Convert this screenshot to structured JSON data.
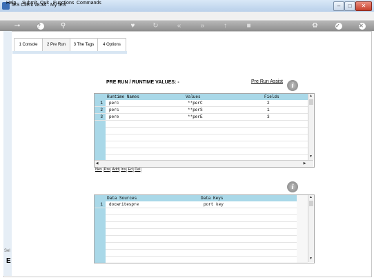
{
  "window": {
    "title": "IES Client v8.34 : My IES",
    "menu": [
      "Help",
      "Submit",
      "Quit",
      "Functions",
      "Commands"
    ]
  },
  "toolbar": {
    "icons": [
      "key-icon",
      "help-icon",
      "search-icon",
      "heart-icon",
      "refresh-icon",
      "rewind-icon",
      "fast-forward-icon",
      "upload-icon",
      "stop-icon",
      "settings-icon",
      "check-icon",
      "close-icon"
    ]
  },
  "tabs": [
    {
      "label": "1 Console"
    },
    {
      "label": "2 Pre Run"
    },
    {
      "label": "3 The Tags"
    },
    {
      "label": "4 Options"
    }
  ],
  "prerun": {
    "title": "PRE RUN / RUNTIME VALUES: -",
    "assist_link": "Pre Run Assist",
    "columns": [
      "Runtime Names",
      "Values",
      "Fields"
    ],
    "rows": [
      {
        "num": "1",
        "name": "perc",
        "value": "**perC",
        "field": "2"
      },
      {
        "num": "2",
        "name": "pers",
        "value": "**perS",
        "field": "1"
      },
      {
        "num": "3",
        "name": "pere",
        "value": "**perE",
        "field": "3"
      }
    ],
    "buttons": [
      "Nex",
      "Pre",
      "Add",
      "Ins",
      "Ed",
      "Del"
    ]
  },
  "datasources": {
    "columns": [
      "Data Sources",
      "Data Keys"
    ],
    "rows": [
      {
        "num": "1",
        "source": "docwritespre",
        "key": "port key"
      }
    ]
  },
  "sidebar": {
    "small_label": "Sel",
    "letter": "E"
  }
}
